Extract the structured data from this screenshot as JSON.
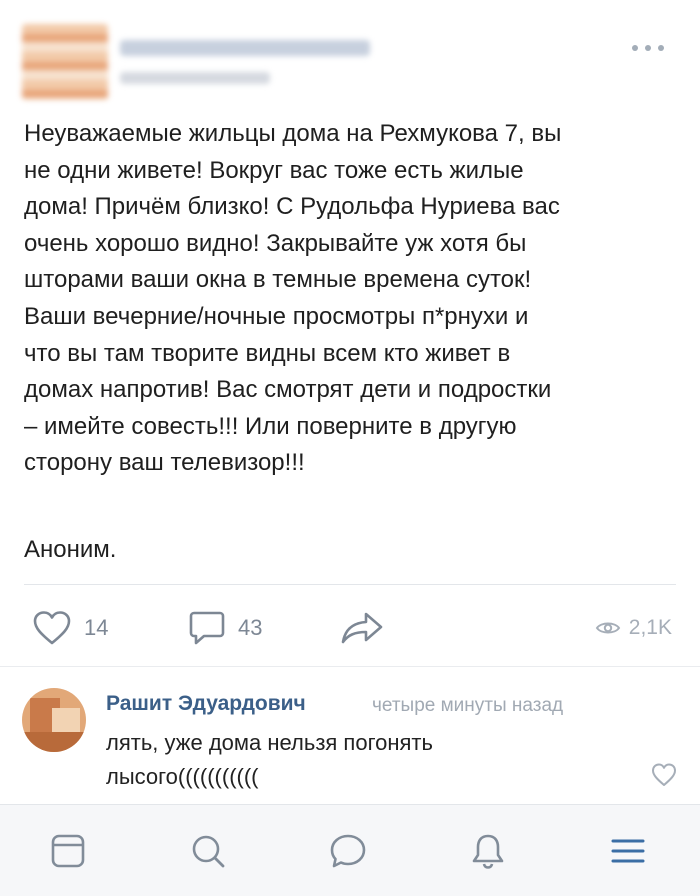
{
  "post": {
    "text_lines": [
      "Неуважаемые жильцы дома на Рехмукова 7, вы",
      "не одни живете! Вокруг вас тоже есть жилые",
      "дома! Причём близко! С Рудольфа Нуриева вас",
      "очень хорошо видно! Закрывайте уж хотя бы",
      "шторами ваши окна в темные времена суток!",
      "Ваши вечерние/ночные просмотры п*рнухи и",
      "что вы там творите видны всем кто живет в",
      "домах напротив! Вас смотрят дети и подростки",
      "– имейте совесть!!! Или поверните в другую",
      "сторону ваш телевизор!!!"
    ],
    "signature": "Аноним."
  },
  "actions": {
    "likes_count": "14",
    "comments_count": "43",
    "views_count": "2,1K"
  },
  "comment": {
    "author": "Рашит Эдуардович",
    "time": "четыре минуты назад",
    "text_lines": [
      "лять, уже дома нельзя погонять",
      "лысого((((((((((("
    ]
  },
  "icons": {
    "more": "more-horizontal-icon",
    "like": "heart-icon",
    "comment": "comment-bubble-icon",
    "share": "share-arrow-icon",
    "views": "eye-icon",
    "news": "news-feed-icon",
    "search": "search-icon",
    "messages": "messages-icon",
    "notifications": "bell-icon",
    "menu": "menu-icon"
  },
  "colors": {
    "accent": "#3b5f88",
    "icon_gray": "#7d8794",
    "tab_icon": "#818c99"
  }
}
